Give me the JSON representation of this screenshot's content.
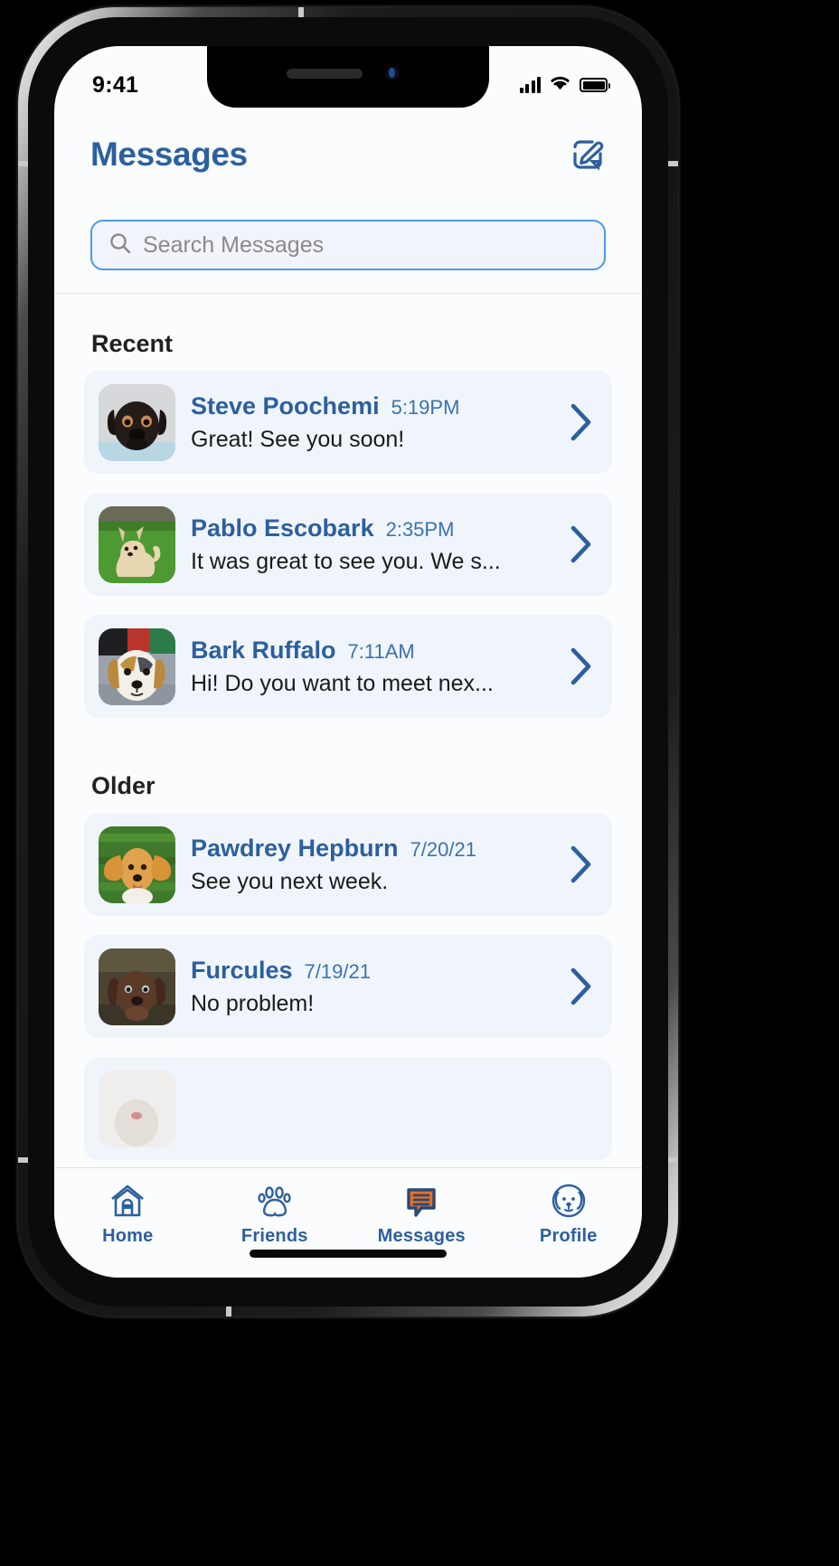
{
  "status_bar": {
    "time": "9:41",
    "signal_icon": "cellular-signal-icon",
    "wifi_icon": "wifi-icon",
    "battery_icon": "battery-icon"
  },
  "header": {
    "title": "Messages",
    "compose_icon": "compose-icon"
  },
  "search": {
    "placeholder": "Search Messages",
    "value": "",
    "icon": "search-icon",
    "border_color": "#4a9aee",
    "background_color": "#f1f5fb"
  },
  "theme": {
    "accent_blue": "#2d5f9e",
    "row_background": "#f0f5fc",
    "screen_background": "#fbfcfd",
    "active_tab_orange": "#ee6f1f",
    "preview_text": "#1a1a1a"
  },
  "sections": [
    {
      "label": "Recent",
      "rows": [
        {
          "name": "Steve Poochemi",
          "time": "5:19PM",
          "preview": "Great! See you soon!",
          "avatar": "black-pug-photo",
          "chevron_icon": "chevron-right-icon"
        },
        {
          "name": "Pablo Escobark",
          "time": "2:35PM",
          "preview": "It was great to see you. We s...",
          "avatar": "chihuahua-on-grass-photo",
          "chevron_icon": "chevron-right-icon"
        },
        {
          "name": "Bark Ruffalo",
          "time": "7:11AM",
          "preview": "Hi! Do you want to meet nex...",
          "avatar": "australian-shepherd-photo",
          "chevron_icon": "chevron-right-icon"
        }
      ]
    },
    {
      "label": "Older",
      "rows": [
        {
          "name": "Pawdrey Hepburn",
          "time": "7/20/21",
          "preview": "See you next week.",
          "avatar": "golden-dachshund-photo",
          "chevron_icon": "chevron-right-icon"
        },
        {
          "name": "Furcules",
          "time": "7/19/21",
          "preview": "No problem!",
          "avatar": "brown-puppy-photo",
          "chevron_icon": "chevron-right-icon"
        }
      ]
    }
  ],
  "tab_bar": {
    "items": [
      {
        "label": "Home",
        "icon": "house-icon",
        "active": false
      },
      {
        "label": "Friends",
        "icon": "paw-print-icon",
        "active": false
      },
      {
        "label": "Messages",
        "icon": "chat-bubble-icon",
        "active": true
      },
      {
        "label": "Profile",
        "icon": "dog-face-icon",
        "active": false
      }
    ]
  }
}
